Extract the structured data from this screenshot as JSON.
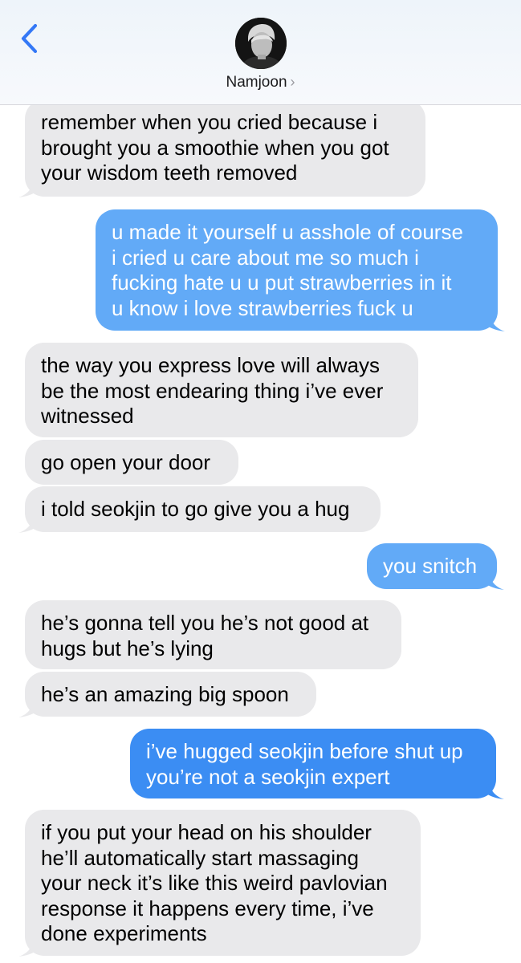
{
  "header": {
    "contact_name": "Namjoon",
    "chevron": "›",
    "back_icon": "chevron-left-icon",
    "avatar": "contact-avatar-photo"
  },
  "colors": {
    "received_bubble": "#e9e9eb",
    "sent_bubble": "#3b8df3",
    "sent_bubble_light": "#62aaf7",
    "accent": "#3478f6"
  },
  "messages": [
    {
      "direction": "received",
      "text": "remember when you cried because i\nbrought you a smoothie when you got\nyour wisdom teeth removed"
    },
    {
      "direction": "sent",
      "text": "u made it yourself u asshole of course\ni cried u care about me so much i\nfucking hate u u put strawberries in it\nu know i love strawberries fuck u"
    },
    {
      "direction": "received",
      "text": "the way you express love will always\nbe the most endearing thing i’ve ever\nwitnessed"
    },
    {
      "direction": "received",
      "text": "go open your door"
    },
    {
      "direction": "received",
      "text": "i told seokjin to go give you a hug"
    },
    {
      "direction": "sent",
      "text": "you snitch"
    },
    {
      "direction": "received",
      "text": "he’s gonna tell you he’s not good at\nhugs but he’s lying"
    },
    {
      "direction": "received",
      "text": "he’s an amazing big spoon"
    },
    {
      "direction": "sent",
      "text": "i’ve hugged seokjin before shut up\nyou’re not a seokjin expert"
    },
    {
      "direction": "received",
      "text": "if you put your head on his shoulder\nhe’ll automatically start massaging\nyour neck it’s like this weird pavlovian\nresponse it happens every time, i’ve\ndone experiments"
    }
  ]
}
